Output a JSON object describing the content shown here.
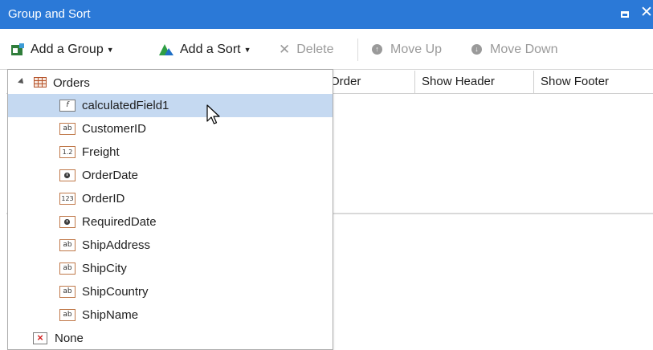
{
  "window": {
    "title": "Group and Sort",
    "maximize_icon": "maximize-icon",
    "close_glyph": "✕"
  },
  "toolbar": {
    "add_group": {
      "label": "Add a Group",
      "icon": "add-group-icon"
    },
    "add_sort": {
      "label": "Add a Sort",
      "icon": "add-sort-icon"
    },
    "delete": {
      "label": "Delete",
      "icon": "delete-icon",
      "enabled": false
    },
    "move_up": {
      "label": "Move Up",
      "icon": "move-up-icon",
      "enabled": false
    },
    "move_down": {
      "label": "Move Down",
      "icon": "move-down-icon",
      "enabled": false
    }
  },
  "grid": {
    "columns": [
      {
        "label": "Order"
      },
      {
        "label": "Show Header"
      },
      {
        "label": "Show Footer"
      }
    ]
  },
  "dropdown": {
    "root": {
      "label": "Orders",
      "icon": "table-icon",
      "expanded": true
    },
    "fields": [
      {
        "label": "calculatedField1",
        "icon_text": "f",
        "icon": "calculated-field-icon",
        "selected": true
      },
      {
        "label": "CustomerID",
        "icon_text": "ab",
        "icon": "string-field-icon"
      },
      {
        "label": "Freight",
        "icon_text": "1.2",
        "icon": "decimal-field-icon"
      },
      {
        "label": "OrderDate",
        "icon_text": "",
        "icon": "date-field-icon"
      },
      {
        "label": "OrderID",
        "icon_text": "123",
        "icon": "integer-field-icon"
      },
      {
        "label": "RequiredDate",
        "icon_text": "",
        "icon": "date-field-icon"
      },
      {
        "label": "ShipAddress",
        "icon_text": "ab",
        "icon": "string-field-icon"
      },
      {
        "label": "ShipCity",
        "icon_text": "ab",
        "icon": "string-field-icon"
      },
      {
        "label": "ShipCountry",
        "icon_text": "ab",
        "icon": "string-field-icon"
      },
      {
        "label": "ShipName",
        "icon_text": "ab",
        "icon": "string-field-icon"
      }
    ],
    "none": {
      "label": "None",
      "icon": "none-icon"
    }
  },
  "colors": {
    "titlebar": "#2b79d7",
    "selection": "#c5d9f1",
    "disabled_text": "#9a9a9a"
  }
}
